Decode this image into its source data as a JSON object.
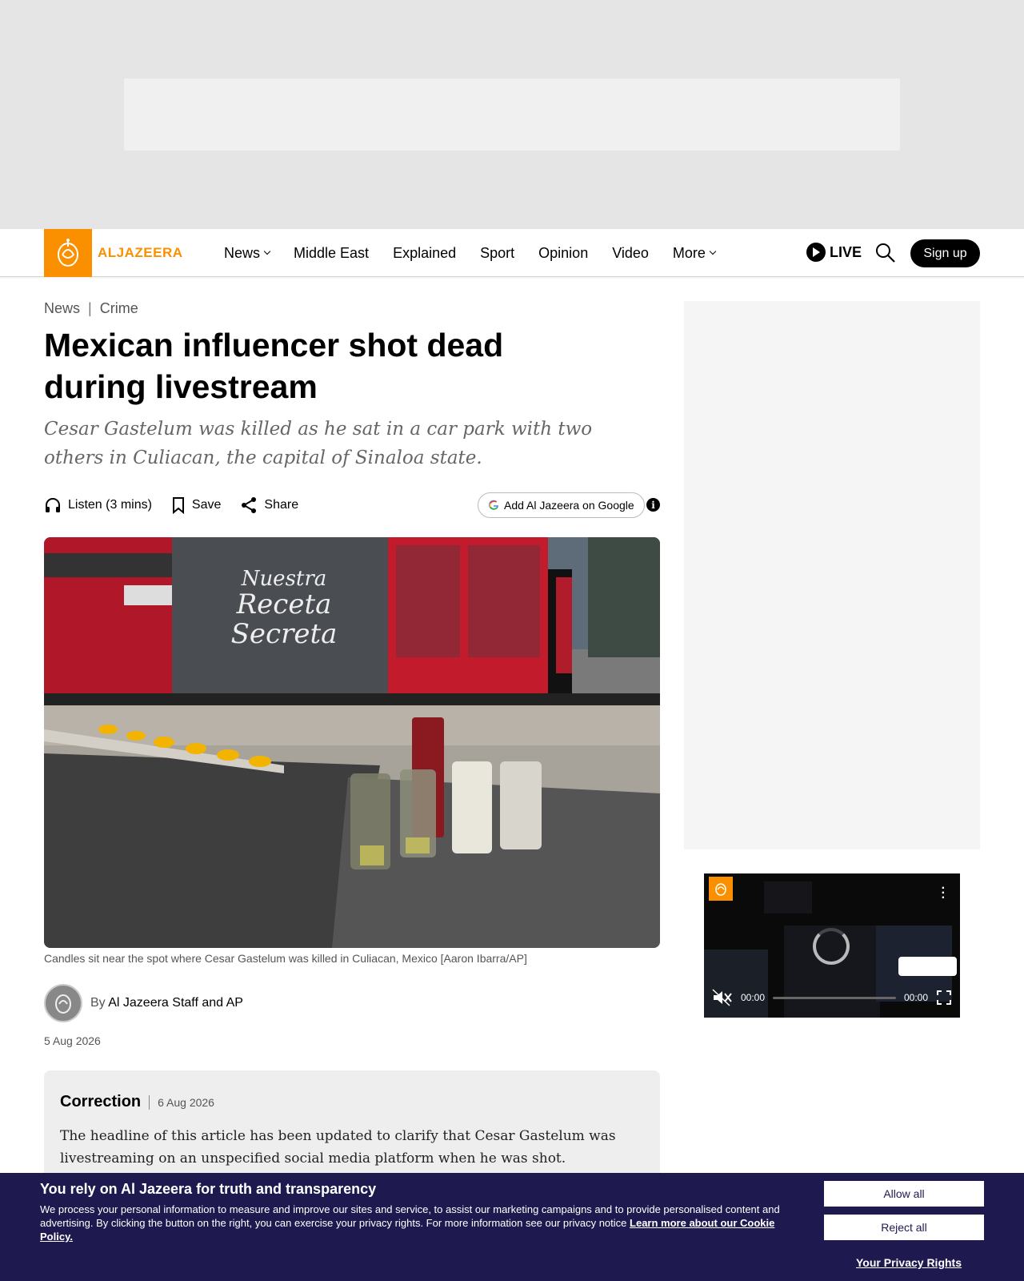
{
  "brand": {
    "name": "ALJAZEERA",
    "color": "#fa9000"
  },
  "nav": {
    "items": [
      {
        "label": "News",
        "dropdown": true
      },
      {
        "label": "Middle East",
        "dropdown": false
      },
      {
        "label": "Explained",
        "dropdown": false
      },
      {
        "label": "Sport",
        "dropdown": false
      },
      {
        "label": "Opinion",
        "dropdown": false
      },
      {
        "label": "Video",
        "dropdown": false
      },
      {
        "label": "More",
        "dropdown": true
      }
    ],
    "live_label": "LIVE",
    "signup_label": "Sign up"
  },
  "breadcrumb": {
    "section": "News",
    "separator": "|",
    "topic": "Crime"
  },
  "article": {
    "headline": "Mexican influencer shot dead during livestream",
    "subheadline": "Cesar Gastelum was killed as he sat in a car park with two others in Culiacan, the capital of Sinaloa state.",
    "actions": {
      "listen": "Listen (3 mins)",
      "save": "Save",
      "share": "Share"
    },
    "google_button": "Add Al Jazeera on Google",
    "image_caption": "Candles sit near the spot where Cesar Gastelum was killed in Culiacan, Mexico [Aaron Ibarra/AP]",
    "byline_prefix": "By",
    "author": "Al Jazeera Staff and AP",
    "date": "5 Aug 2026",
    "correction": {
      "title": "Correction",
      "date": "6 Aug 2026",
      "body": "The headline of this article has been updated to clarify that Cesar Gastelum was livestreaming on an unspecified social media platform when he was shot."
    }
  },
  "video": {
    "time_current": "00:00",
    "time_total": "00:00"
  },
  "cookie": {
    "title": "You rely on Al Jazeera for truth and transparency",
    "body": "We process your personal information to measure and improve our sites and service, to assist our marketing campaigns and to provide personalised content and advertising. By clicking the button on the right, you can exercise your privacy rights. For more information see our privacy notice",
    "link": "Learn more about our Cookie Policy.",
    "allow": "Allow all",
    "reject": "Reject all",
    "privacy": "Your Privacy Rights"
  }
}
